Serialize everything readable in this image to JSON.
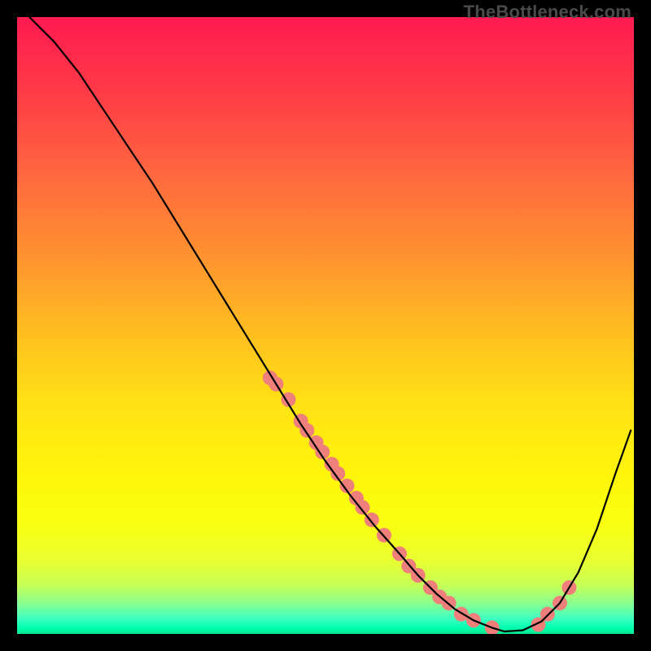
{
  "watermark": "TheBottleneck.com",
  "chart_data": {
    "type": "line",
    "title": "",
    "xlabel": "",
    "ylabel": "",
    "xlim": [
      0,
      100
    ],
    "ylim": [
      0,
      100
    ],
    "series": [
      {
        "name": "curve",
        "x": [
          2,
          6,
          10,
          14,
          18,
          22,
          26,
          30,
          34,
          38,
          42,
          46,
          50,
          54,
          58,
          62,
          65,
          68,
          71,
          74,
          77,
          79,
          82,
          85,
          88,
          91,
          94,
          97,
          99.5
        ],
        "y": [
          100,
          96,
          91,
          85,
          79,
          73,
          66.5,
          60,
          53.5,
          47,
          40.5,
          34,
          28,
          22.5,
          17.5,
          13,
          9.5,
          6.5,
          4,
          2.2,
          1,
          0.4,
          0.6,
          2,
          5,
          10,
          17,
          26,
          33
        ]
      }
    ],
    "markers": {
      "name": "points-on-curve",
      "color": "#ef7f7a",
      "radius": 9,
      "x": [
        41,
        42,
        44,
        46,
        47,
        48.5,
        49.5,
        51,
        52,
        53.5,
        55,
        56,
        57.5,
        59.5,
        62,
        63.5,
        65,
        67,
        68.5,
        70,
        72,
        74,
        77,
        84.5,
        86,
        88,
        89.5
      ],
      "y": [
        41.5,
        40.5,
        38,
        34.5,
        33,
        31,
        29.5,
        27.5,
        26,
        24,
        22,
        20.5,
        18.5,
        16,
        13,
        11,
        9.5,
        7.5,
        6,
        5,
        3.2,
        2.2,
        1,
        1.5,
        3.2,
        5,
        7.5
      ]
    }
  }
}
